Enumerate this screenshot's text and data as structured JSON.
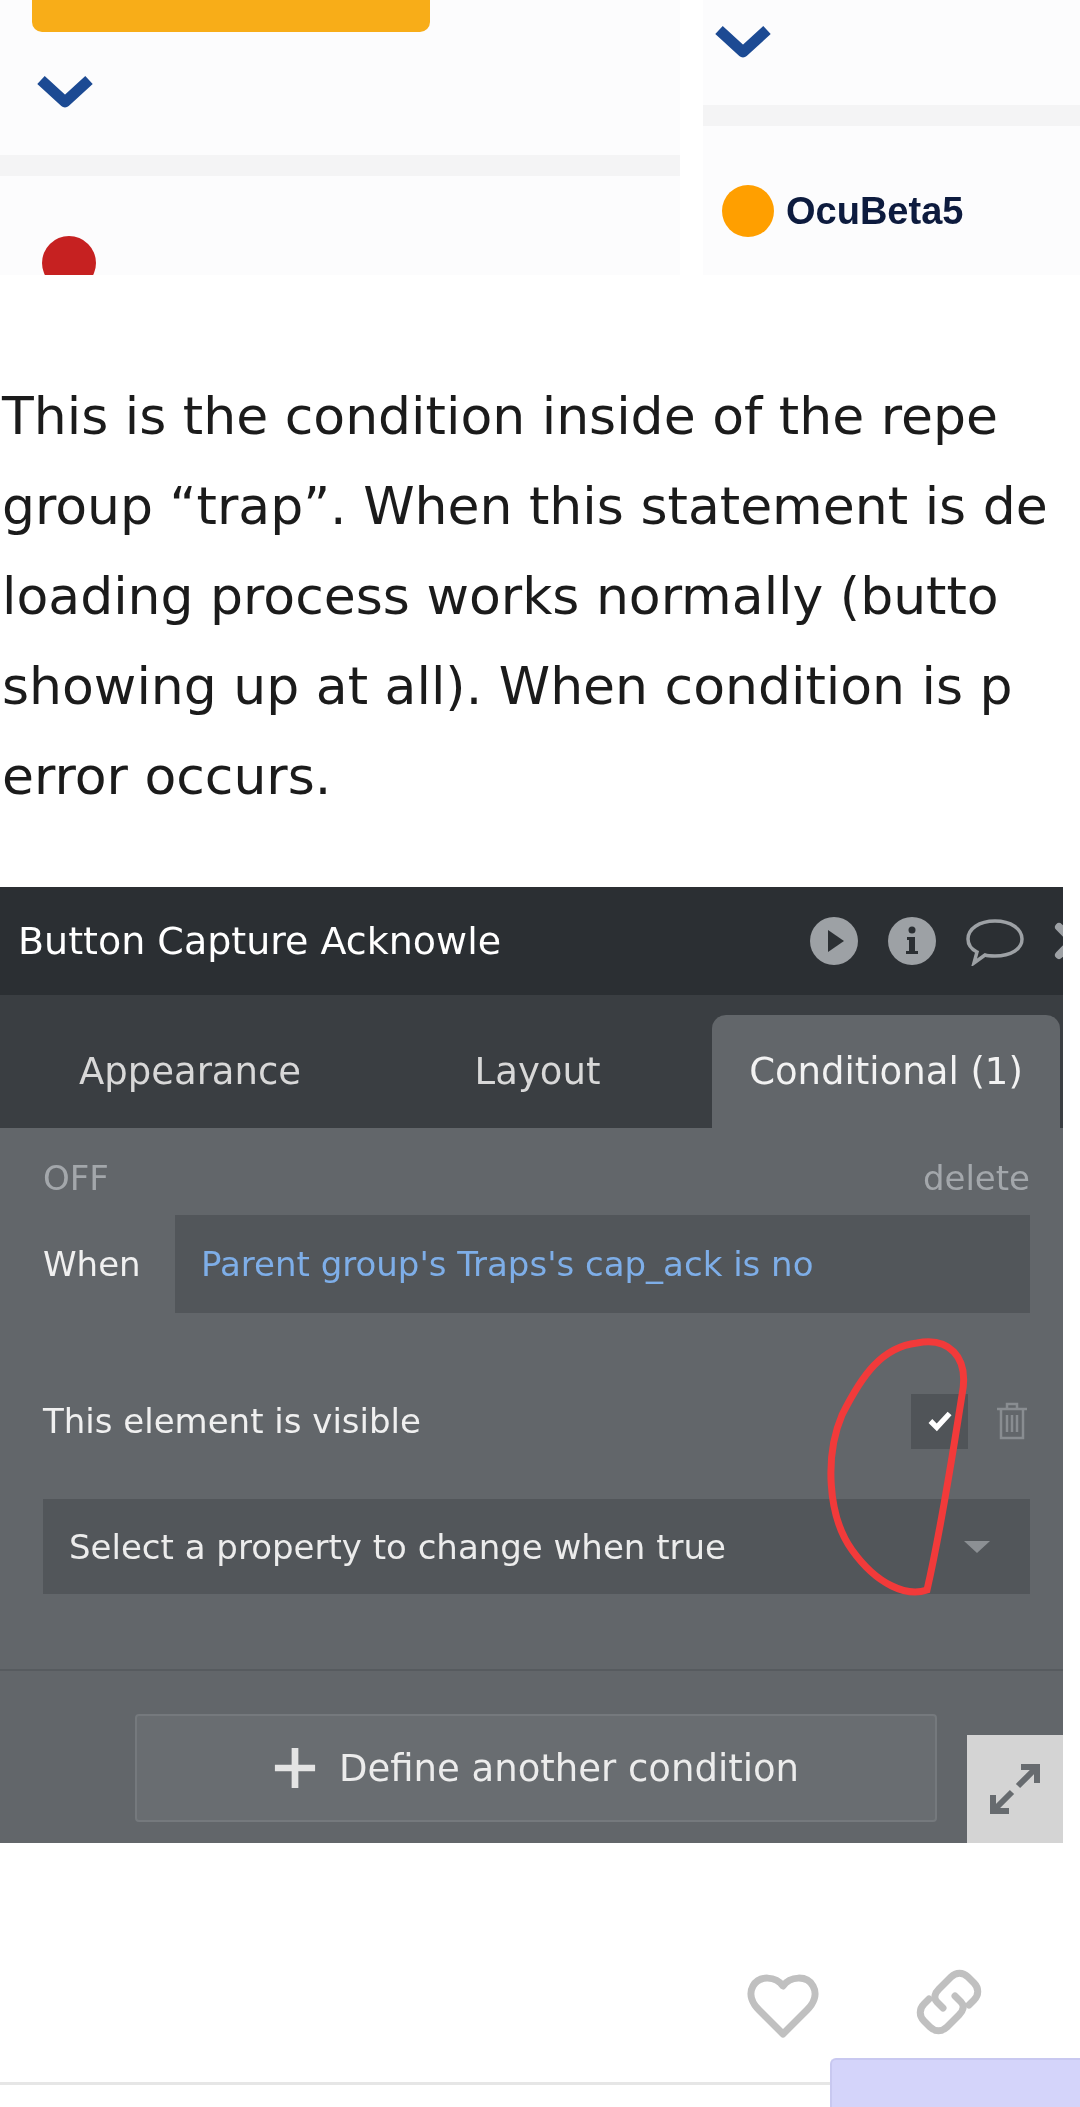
{
  "cards": [
    {
      "kind": "button_card",
      "color": "#c62121"
    },
    {
      "kind": "name_card",
      "name": "OcuBeta5",
      "color": "#ff9f00"
    }
  ],
  "paragraph_lines": [
    "This is the condition inside of the repe",
    "group “trap”. When this statement is de",
    "loading process works normally (butto",
    "showing up at all). When condition is p",
    "error occurs."
  ],
  "panel": {
    "title": "Button Capture Acknowle",
    "tabs": [
      {
        "label": "Appearance",
        "selected": false
      },
      {
        "label": "Layout",
        "selected": false
      },
      {
        "label": "Conditional (1)",
        "selected": true
      }
    ],
    "condition": {
      "status": "OFF",
      "delete": "delete",
      "when_label": "When",
      "expression": "Parent group's Traps's cap_ack is no",
      "property_label": "This element is visible",
      "checked": true,
      "placeholder": "Select a property to change when true"
    },
    "add_button": "Define another condition"
  }
}
